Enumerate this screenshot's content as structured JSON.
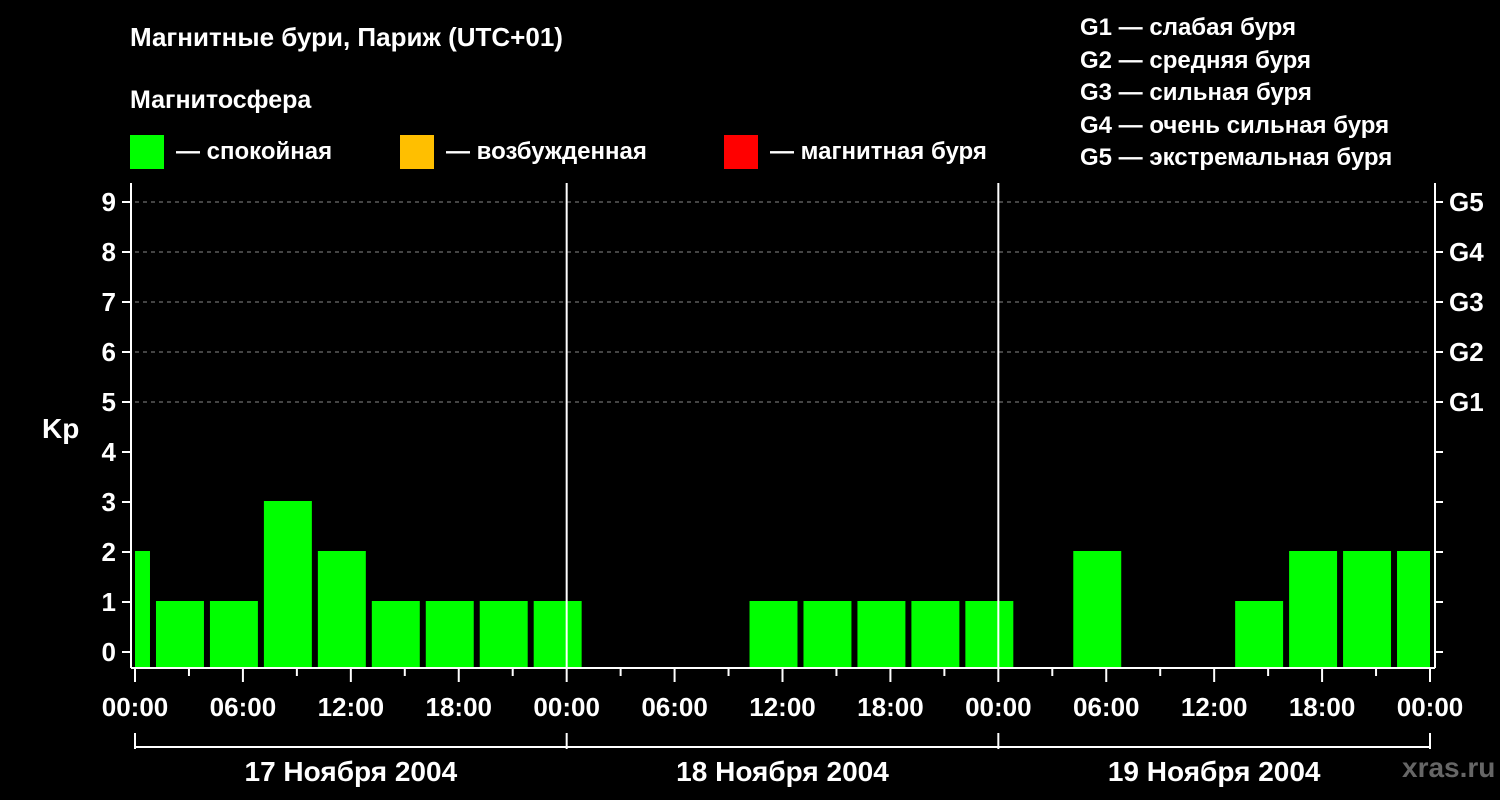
{
  "header": {
    "title": "Магнитные бури, Париж (UTC+01)",
    "subtitle": "Магнитосфера"
  },
  "legend": [
    {
      "label": "— спокойная",
      "color": "#00ff00"
    },
    {
      "label": "— возбужденная",
      "color": "#ffbf00"
    },
    {
      "label": "— магнитная буря",
      "color": "#ff0000"
    }
  ],
  "storm_levels": [
    "G1 — слабая буря",
    "G2 — средняя буря",
    "G3 — сильная буря",
    "G4 — очень сильная буря",
    "G5 — экстремальная буря"
  ],
  "watermark": "xras.ru",
  "chart_data": {
    "type": "bar",
    "ylabel": "Kp",
    "ylim": [
      0,
      9
    ],
    "yticks": [
      "0",
      "1",
      "2",
      "3",
      "4",
      "5",
      "6",
      "7",
      "8",
      "9"
    ],
    "right_ticks": [
      {
        "kp": 5,
        "label": "G1"
      },
      {
        "kp": 6,
        "label": "G2"
      },
      {
        "kp": 7,
        "label": "G3"
      },
      {
        "kp": 8,
        "label": "G4"
      },
      {
        "kp": 9,
        "label": "G5"
      }
    ],
    "grid": "dashed horizontal at 5-9",
    "xtick_labels": [
      "00:00",
      "06:00",
      "12:00",
      "18:00",
      "00:00",
      "06:00",
      "12:00",
      "18:00",
      "00:00",
      "06:00",
      "12:00",
      "18:00",
      "00:00"
    ],
    "days": [
      "17 Ноября 2004",
      "18 Ноября 2004",
      "19 Ноября 2004"
    ],
    "bar_color": "#00ff00",
    "series": [
      {
        "values": [
          [
            2,
            1,
            1,
            3,
            2,
            1,
            1,
            1,
            1
          ],
          [
            null,
            null,
            1,
            1,
            1,
            1,
            1,
            null,
            2,
            null
          ],
          [
            null,
            1,
            2,
            2,
            2
          ]
        ]
      }
    ],
    "bars": [
      {
        "start_hour": 0,
        "end_hour": 1,
        "kp": 2
      },
      {
        "start_hour": 1,
        "end_hour": 4,
        "kp": 1
      },
      {
        "start_hour": 4,
        "end_hour": 7,
        "kp": 1
      },
      {
        "start_hour": 7,
        "end_hour": 10,
        "kp": 3
      },
      {
        "start_hour": 10,
        "end_hour": 13,
        "kp": 2
      },
      {
        "start_hour": 13,
        "end_hour": 16,
        "kp": 1
      },
      {
        "start_hour": 16,
        "end_hour": 19,
        "kp": 1
      },
      {
        "start_hour": 19,
        "end_hour": 22,
        "kp": 1
      },
      {
        "start_hour": 22,
        "end_hour": 25,
        "kp": 1
      },
      {
        "start_hour": 34,
        "end_hour": 37,
        "kp": 1
      },
      {
        "start_hour": 37,
        "end_hour": 40,
        "kp": 1
      },
      {
        "start_hour": 40,
        "end_hour": 43,
        "kp": 1
      },
      {
        "start_hour": 43,
        "end_hour": 46,
        "kp": 1
      },
      {
        "start_hour": 46,
        "end_hour": 49,
        "kp": 1
      },
      {
        "start_hour": 52,
        "end_hour": 55,
        "kp": 2
      },
      {
        "start_hour": 61,
        "end_hour": 64,
        "kp": 1
      },
      {
        "start_hour": 64,
        "end_hour": 67,
        "kp": 2
      },
      {
        "start_hour": 67,
        "end_hour": 70,
        "kp": 2
      },
      {
        "start_hour": 70,
        "end_hour": 72,
        "kp": 2
      }
    ]
  }
}
